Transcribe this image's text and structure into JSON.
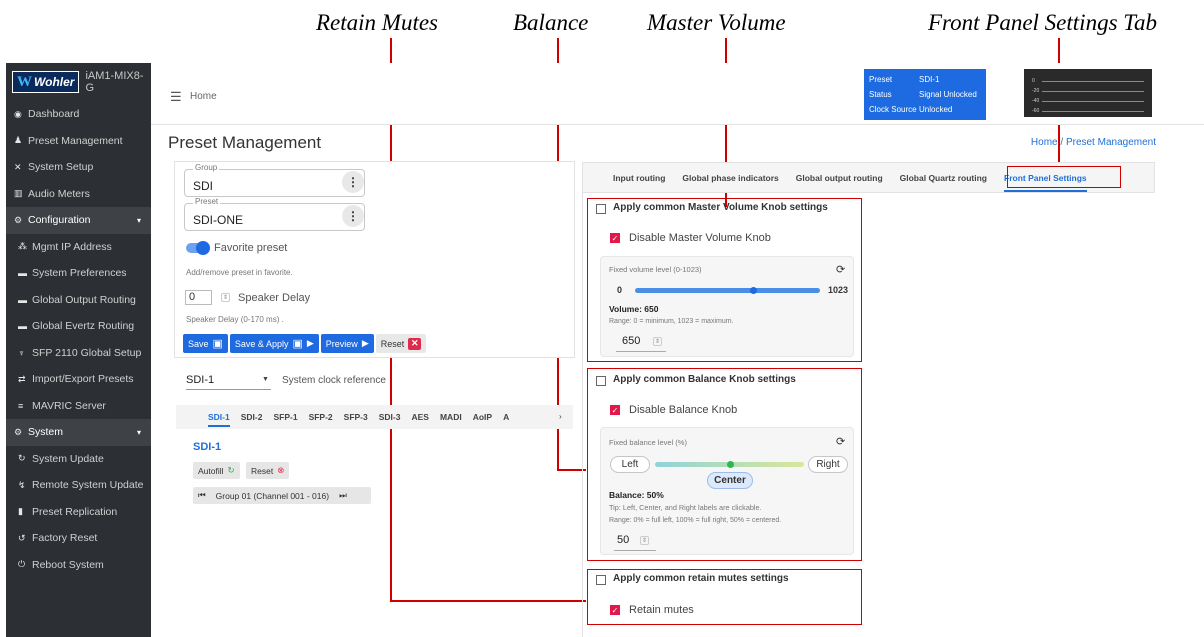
{
  "callouts": {
    "retain_mutes": "Retain Mutes",
    "balance": "Balance",
    "master_volume": "Master Volume",
    "front_panel_tab": "Front Panel Settings Tab"
  },
  "brand": {
    "logo_w": "W",
    "logo_text": "Wohler",
    "model": "iAM1-MIX8-G"
  },
  "sidebar": {
    "items": [
      {
        "label": "Dashboard",
        "icon": "dashboard-icon",
        "glyph": "◉"
      },
      {
        "label": "Preset Management",
        "icon": "user-edit-icon",
        "glyph": "♟"
      },
      {
        "label": "System Setup",
        "icon": "tools-icon",
        "glyph": "✕"
      },
      {
        "label": "Audio Meters",
        "icon": "bar-chart-icon",
        "glyph": "▥"
      }
    ],
    "configuration": {
      "label": "Configuration",
      "items": [
        {
          "label": "Mgmt IP Address",
          "glyph": "⁂"
        },
        {
          "label": "System Preferences",
          "glyph": "▬"
        },
        {
          "label": "Global Output Routing",
          "glyph": "▬"
        },
        {
          "label": "Global Evertz Routing",
          "glyph": "▬"
        },
        {
          "label": "SFP 2110 Global Setup",
          "glyph": "♆"
        },
        {
          "label": "Import/Export Presets",
          "glyph": "⇄"
        },
        {
          "label": "MAVRIC Server",
          "glyph": "≡"
        }
      ]
    },
    "system": {
      "label": "System",
      "items": [
        {
          "label": "System Update",
          "glyph": "↻"
        },
        {
          "label": "Remote System Update",
          "glyph": "↯"
        },
        {
          "label": "Preset Replication",
          "glyph": "▮"
        },
        {
          "label": "Factory Reset",
          "glyph": "↺"
        },
        {
          "label": "Reboot System",
          "glyph": "⏻"
        }
      ]
    }
  },
  "header": {
    "home": "Home",
    "status": {
      "rows": [
        {
          "key": "Preset",
          "value": "SDI-1"
        },
        {
          "key": "Status",
          "value": "Signal Unlocked"
        },
        {
          "key": "Clock Source",
          "value": "Unlocked"
        }
      ]
    },
    "meter_labels": [
      "0",
      "-20",
      "-40",
      "-60"
    ]
  },
  "page": {
    "title": "Preset Management",
    "breadcrumb_home": "Home",
    "breadcrumb_sep": "/",
    "breadcrumb_current": "Preset Management"
  },
  "left": {
    "group_legend": "Group",
    "group_value": "SDI",
    "preset_legend": "Preset",
    "preset_value": "SDI-ONE",
    "favorite_label": "Favorite preset",
    "favorite_on": true,
    "favorite_help": "Add/remove preset in favorite.",
    "speaker_delay_value": "0",
    "speaker_delay_label": "Speaker Delay",
    "speaker_delay_help": "Speaker Delay (0-170 ms) .",
    "buttons": {
      "save": "Save",
      "save_apply": "Save & Apply",
      "preview": "Preview",
      "reset": "Reset"
    },
    "clock_select": "SDI-1",
    "clock_label": "System clock reference",
    "sdi_tabs": [
      "SDI-1",
      "SDI-2",
      "SFP-1",
      "SFP-2",
      "SFP-3",
      "SDI-3",
      "AES",
      "MADI",
      "AoIP",
      "A"
    ],
    "sdi_tab_active": "SDI-1",
    "sdi_title": "SDI-1",
    "autofill": "Autofill",
    "reset_small": "Reset",
    "group_nav": "Group 01 (Channel 001 - 016)"
  },
  "right": {
    "tabs": [
      "Input routing",
      "Global phase indicators",
      "Global output routing",
      "Global Quartz routing",
      "Front Panel Settings"
    ],
    "tab_active": "Front Panel Settings",
    "master": {
      "header": "Apply common Master Volume Knob settings",
      "disable_label": "Disable Master Volume Knob",
      "disable_checked": true,
      "field_label": "Fixed volume level (0-1023)",
      "min": "0",
      "max": "1023",
      "value": 650,
      "value_text": "Volume: 650",
      "range_text": "Range: 0 = minimum, 1023 = maximum.",
      "input_value": "650"
    },
    "balance": {
      "header": "Apply common Balance Knob settings",
      "disable_label": "Disable Balance Knob",
      "disable_checked": true,
      "field_label": "Fixed balance level (%)",
      "left": "Left",
      "center": "Center",
      "right": "Right",
      "value": 50,
      "value_text": "Balance: 50%",
      "tip": "Tip: Left, Center, and Right labels are clickable.",
      "range_text": "Range: 0% = full left, 100% = full right, 50% = centered.",
      "input_value": "50"
    },
    "retain": {
      "header": "Apply common retain mutes settings",
      "label": "Retain mutes",
      "checked": true
    }
  }
}
